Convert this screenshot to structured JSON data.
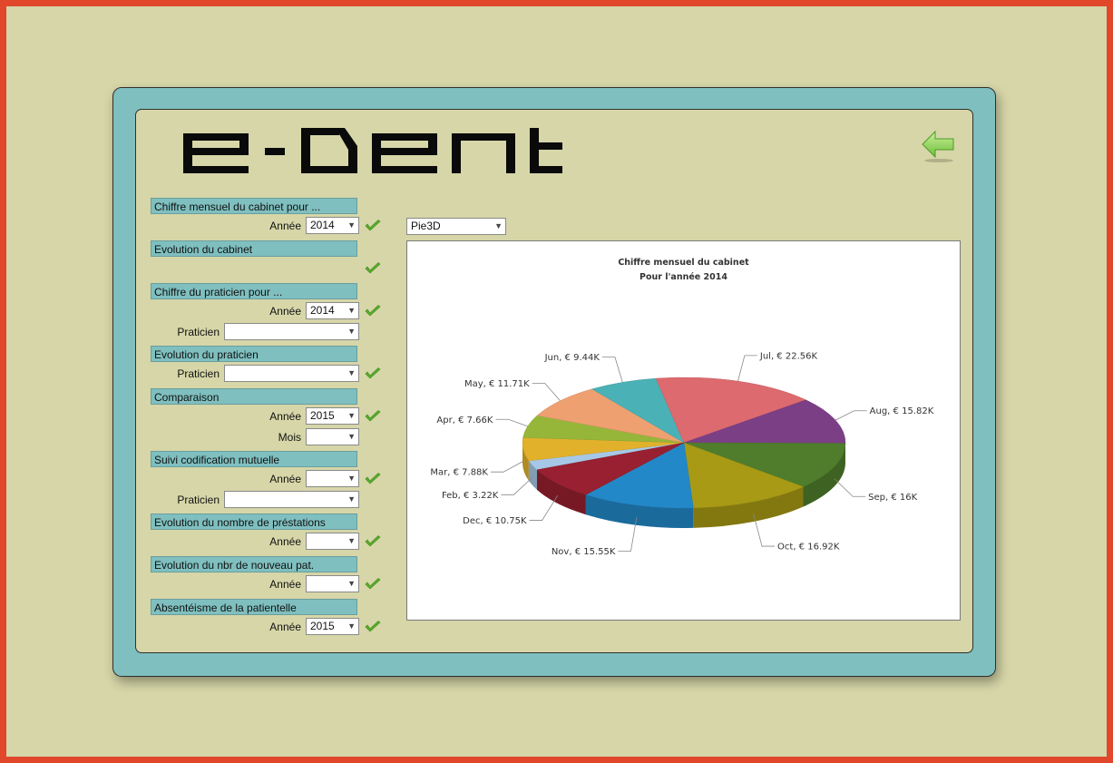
{
  "app": {
    "name": "e-Dent"
  },
  "sections": [
    {
      "title": "Chiffre mensuel du cabinet pour ...",
      "fields": [
        {
          "label": "Année",
          "value": "2014"
        }
      ]
    },
    {
      "title": "Evolution du cabinet",
      "fields": []
    },
    {
      "title": "Chiffre du praticien pour ...",
      "fields": [
        {
          "label": "Année",
          "value": "2014"
        },
        {
          "label": "Praticien",
          "value": ""
        }
      ]
    },
    {
      "title": "Evolution du praticien",
      "fields": [
        {
          "label": "Praticien",
          "value": ""
        }
      ]
    },
    {
      "title": "Comparaison",
      "fields": [
        {
          "label": "Année",
          "value": "2015"
        },
        {
          "label": "Mois",
          "value": ""
        }
      ]
    },
    {
      "title": "Suivi codification mutuelle",
      "fields": [
        {
          "label": "Année",
          "value": ""
        },
        {
          "label": "Praticien",
          "value": ""
        }
      ]
    },
    {
      "title": "Evolution du nombre de préstations",
      "fields": [
        {
          "label": "Année",
          "value": ""
        }
      ]
    },
    {
      "title": "Evolution du nbr de nouveau pat.",
      "fields": [
        {
          "label": "Année",
          "value": ""
        }
      ]
    },
    {
      "title": "Absentéisme de la patientelle",
      "fields": [
        {
          "label": "Année",
          "value": "2015"
        }
      ]
    }
  ],
  "chart_type_select": {
    "value": "Pie3D"
  },
  "colors": {
    "accent": "#7fbfbf",
    "background": "#d6d6a8",
    "frame": "#e0472b",
    "check": "#5aae2a"
  },
  "chart_data": {
    "type": "pie",
    "title": "Chiffre mensuel du cabinet",
    "subtitle": "Pour l'année 2014",
    "slices": [
      {
        "label": "Feb",
        "value": 3.22,
        "display": "Feb, € 3.22K",
        "color": "#a6c8e6"
      },
      {
        "label": "Mar",
        "value": 7.88,
        "display": "Mar, € 7.88K",
        "color": "#e2b12c"
      },
      {
        "label": "Apr",
        "value": 7.66,
        "display": "Apr, € 7.66K",
        "color": "#96b63a"
      },
      {
        "label": "May",
        "value": 11.71,
        "display": "May, € 11.71K",
        "color": "#eea070"
      },
      {
        "label": "Jun",
        "value": 9.44,
        "display": "Jun, € 9.44K",
        "color": "#4ab1b6"
      },
      {
        "label": "Jul",
        "value": 22.56,
        "display": "Jul, € 22.56K",
        "color": "#dc6a6e"
      },
      {
        "label": "Aug",
        "value": 15.82,
        "display": "Aug, € 15.82K",
        "color": "#7b3f86"
      },
      {
        "label": "Sep",
        "value": 16,
        "display": "Sep, € 16K",
        "color": "#4f7d2c"
      },
      {
        "label": "Oct",
        "value": 16.92,
        "display": "Oct, € 16.92K",
        "color": "#a89a14"
      },
      {
        "label": "Nov",
        "value": 15.55,
        "display": "Nov, € 15.55K",
        "color": "#2388c8"
      },
      {
        "label": "Dec",
        "value": 10.75,
        "display": "Dec, € 10.75K",
        "color": "#982030"
      }
    ]
  }
}
